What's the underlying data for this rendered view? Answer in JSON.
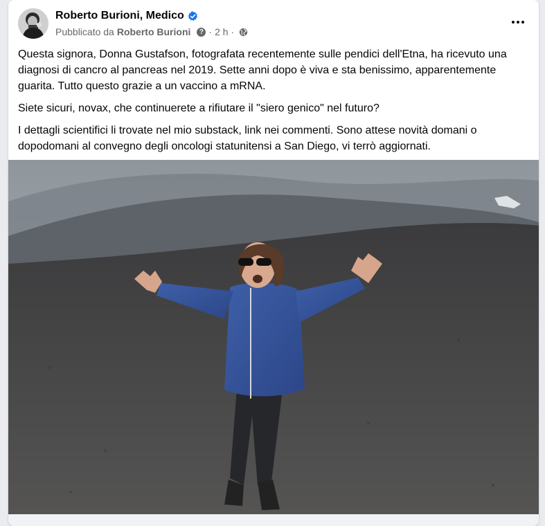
{
  "post": {
    "author": "Roberto Burioni, Medico",
    "published_by_prefix": "Pubblicato da",
    "published_by_name": "Roberto Burioni",
    "separator": "·",
    "time": "2 h",
    "paragraphs": [
      "Questa signora, Donna Gustafson, fotografata recentemente sulle pendici dell'Etna, ha ricevuto una diagnosi di cancro al pancreas nel 2019. Sette anni dopo è viva e sta benissimo, apparentemente guarita. Tutto questo grazie a un vaccino a mRNA.",
      "Siete sicuri, novax, che continuerete a rifiutare il \"siero genico\" nel futuro?",
      "I dettagli scientifici li trovate nel mio substack, link nei commenti. Sono attese novità domani o dopodomani al convegno degli oncologi statunitensi a San Diego, vi terrò aggiornati."
    ],
    "icons": {
      "verified": "verified-badge-icon",
      "help": "question-mark-icon",
      "audience": "globe-icon",
      "menu": "more-options-icon"
    },
    "colors": {
      "verified_blue": "#1877f2",
      "secondary_text": "#65676b"
    }
  }
}
